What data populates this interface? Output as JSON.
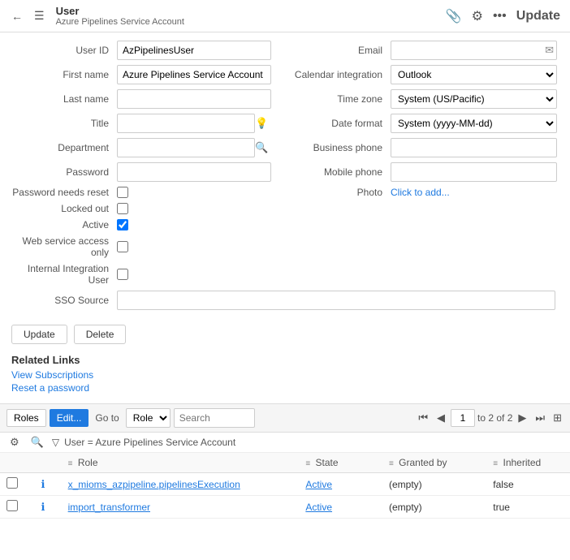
{
  "header": {
    "back_label": "←",
    "menu_label": "☰",
    "main_title": "User",
    "sub_title": "Azure Pipelines Service Account",
    "action_attach": "📎",
    "action_settings": "⚙",
    "action_more": "•••",
    "update_label": "Update"
  },
  "form": {
    "user_id_label": "User ID",
    "user_id_value": "AzPipelinesUser",
    "first_name_label": "First name",
    "first_name_value": "Azure Pipelines Service Account",
    "last_name_label": "Last name",
    "last_name_value": "",
    "title_label": "Title",
    "title_value": "",
    "department_label": "Department",
    "department_value": "",
    "password_label": "Password",
    "password_value": "",
    "password_needs_reset_label": "Password needs reset",
    "locked_out_label": "Locked out",
    "active_label": "Active",
    "web_service_label": "Web service access only",
    "internal_integration_label": "Internal Integration User",
    "sso_source_label": "SSO Source",
    "sso_source_value": "",
    "email_label": "Email",
    "email_value": "",
    "calendar_label": "Calendar integration",
    "calendar_value": "Outlook",
    "timezone_label": "Time zone",
    "timezone_value": "System (US/Pacific)",
    "date_format_label": "Date format",
    "date_format_value": "System (yyyy-MM-dd)",
    "business_phone_label": "Business phone",
    "business_phone_value": "",
    "mobile_phone_label": "Mobile phone",
    "mobile_phone_value": "",
    "photo_label": "Photo",
    "photo_placeholder": "Click to add..."
  },
  "buttons": {
    "update": "Update",
    "delete": "Delete"
  },
  "related_links": {
    "title": "Related Links",
    "view_subscriptions": "View Subscriptions",
    "reset_password": "Reset a password"
  },
  "table_toolbar": {
    "roles_label": "Roles",
    "edit_label": "Edit...",
    "goto_label": "Go to",
    "goto_value": "Role",
    "search_placeholder": "Search",
    "page_current": "1",
    "page_total": "to 2 of 2",
    "grid_icon": "⊞"
  },
  "filter": {
    "icon": "▽",
    "text": "User = Azure Pipelines Service Account"
  },
  "table": {
    "columns": [
      {
        "id": "check",
        "label": ""
      },
      {
        "id": "info",
        "label": ""
      },
      {
        "id": "role",
        "label": "Role"
      },
      {
        "id": "state",
        "label": "State"
      },
      {
        "id": "granted_by",
        "label": "Granted by"
      },
      {
        "id": "inherited",
        "label": "Inherited"
      }
    ],
    "rows": [
      {
        "role": "x_mioms_azpipeline.pipelinesExecution",
        "state": "Active",
        "granted_by": "(empty)",
        "inherited": "false"
      },
      {
        "role": "import_transformer",
        "state": "Active",
        "granted_by": "(empty)",
        "inherited": "true"
      }
    ]
  }
}
